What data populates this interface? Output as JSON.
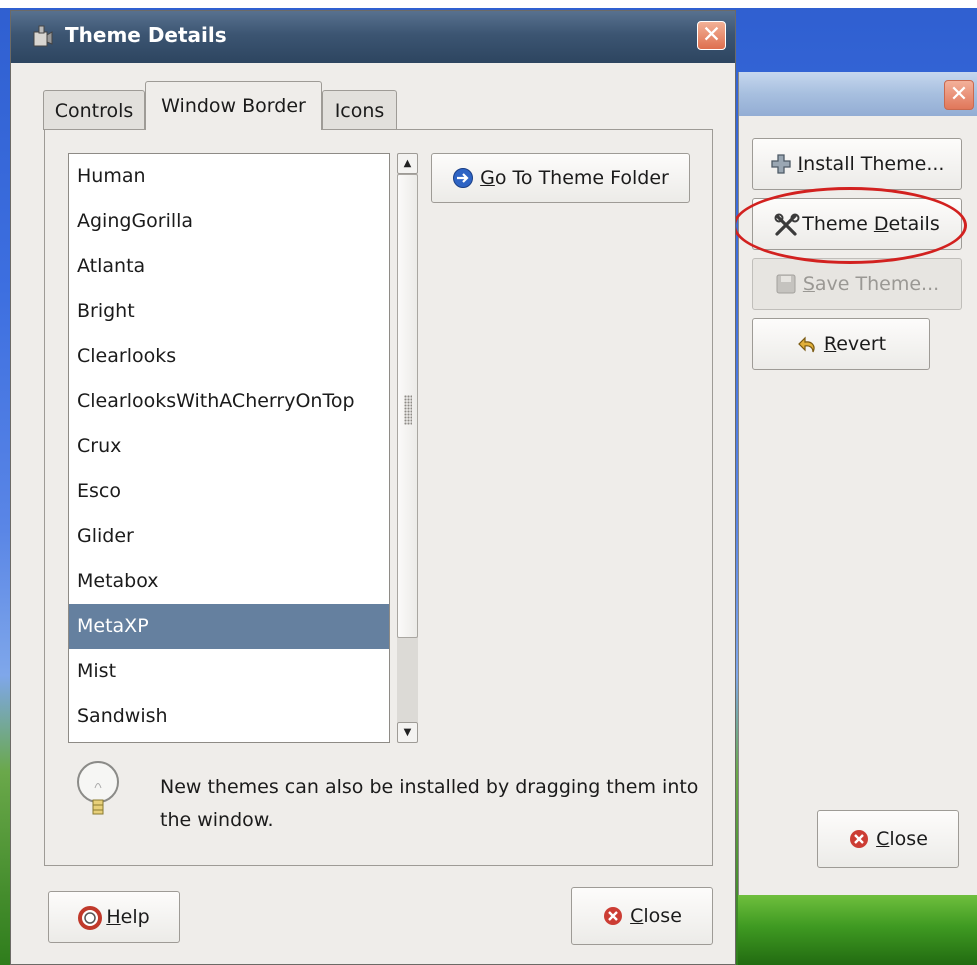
{
  "dialog": {
    "title": "Theme Details",
    "close_glyph": "✕",
    "tabs": [
      {
        "label": "Controls",
        "active": false
      },
      {
        "label": "Window Border",
        "active": true
      },
      {
        "label": "Icons",
        "active": false
      }
    ],
    "themes": [
      "Human",
      "AgingGorilla",
      "Atlanta",
      "Bright",
      "Clearlooks",
      "ClearlooksWithACherryOnTop",
      "Crux",
      "Esco",
      "Glider",
      "Metabox",
      "MetaXP",
      "Mist",
      "Sandwish"
    ],
    "selected_theme": "MetaXP",
    "goto_folder": {
      "mnemonic": "G",
      "rest": "o To Theme Folder"
    },
    "hint": "New themes can also be installed by dragging them into the window.",
    "help": {
      "mnemonic": "H",
      "rest": "elp"
    },
    "close": {
      "mnemonic": "C",
      "rest": "lose"
    }
  },
  "background_window": {
    "close_glyph": "✕",
    "install": {
      "mnemonic": "I",
      "rest": "nstall Theme..."
    },
    "details": {
      "before": "Theme ",
      "mnemonic": "D",
      "rest": "etails"
    },
    "save": {
      "mnemonic": "S",
      "rest": "ave Theme..."
    },
    "revert": {
      "mnemonic": "R",
      "rest": "evert"
    },
    "close": {
      "mnemonic": "C",
      "rest": "lose"
    }
  },
  "icons": {
    "title": "theme-app-icon",
    "goto": "arrow-right-icon",
    "help": "lifebuoy-icon",
    "close": "close-circle-icon",
    "install": "plus-icon",
    "details": "tools-icon",
    "save": "floppy-icon",
    "revert": "undo-arrow-icon",
    "hint": "lightbulb-icon"
  },
  "colors": {
    "selection": "#65809f",
    "annotation": "#d2211f",
    "titlebar": "#3c5572"
  }
}
